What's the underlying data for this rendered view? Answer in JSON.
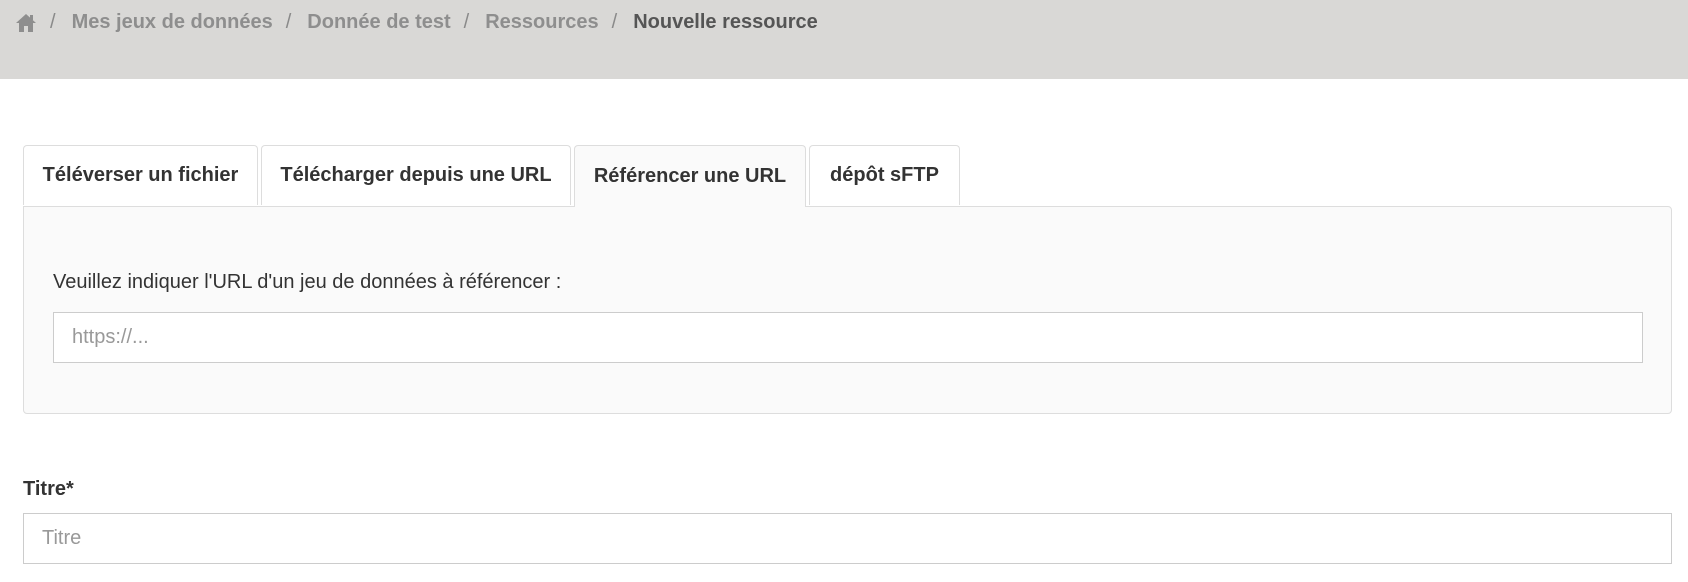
{
  "colors": {
    "breadcrumb_bg": "#d9d8d6",
    "breadcrumb_link": "#8e8e8e",
    "breadcrumb_current": "#555555",
    "panel_bg": "#fafafa",
    "border": "#dddddd"
  },
  "breadcrumb": {
    "home_icon": "home-icon",
    "separator": "/",
    "items": [
      {
        "label": "Mes jeux de données"
      },
      {
        "label": "Donnée de test"
      },
      {
        "label": "Ressources"
      }
    ],
    "current": "Nouvelle ressource"
  },
  "tabs": [
    {
      "label": "Téléverser un fichier",
      "active": false
    },
    {
      "label": "Télécharger depuis une URL",
      "active": false
    },
    {
      "label": "Référencer une URL",
      "active": true
    },
    {
      "label": "dépôt sFTP",
      "active": false
    }
  ],
  "panel": {
    "label": "Veuillez indiquer l'URL d'un jeu de données à référencer :",
    "url_placeholder": "https://...",
    "url_value": ""
  },
  "form": {
    "title_label": "Titre*",
    "title_placeholder": "Titre",
    "title_value": ""
  }
}
